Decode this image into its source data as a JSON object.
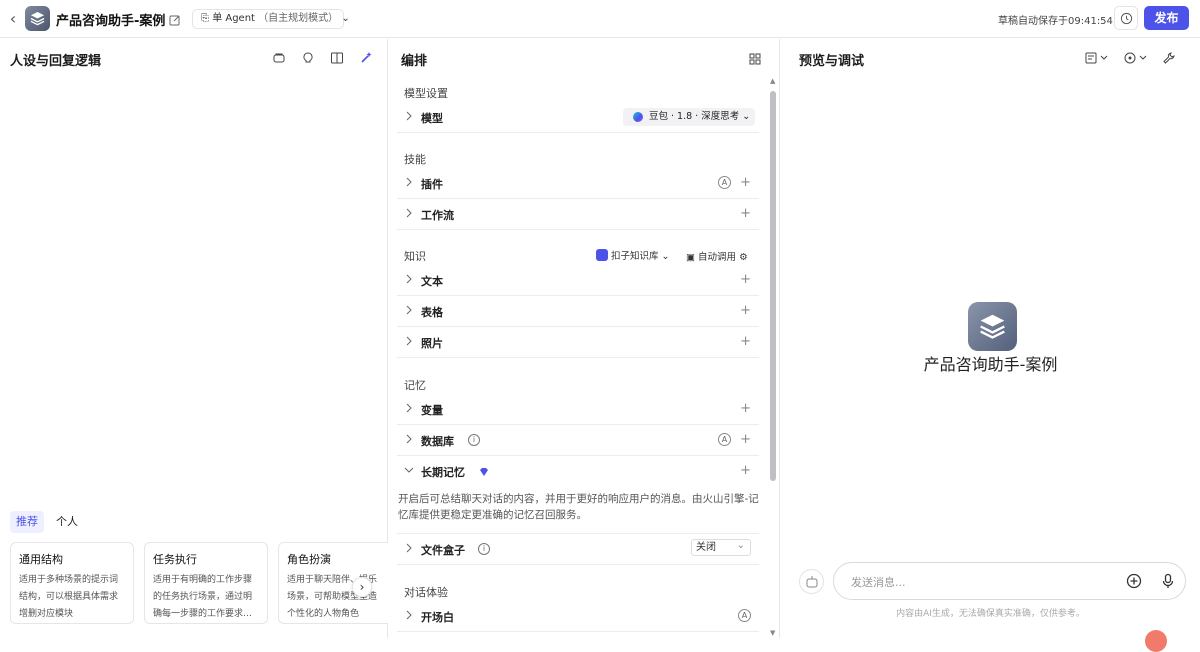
{
  "header": {
    "app_title": "产品咨询助手-案例",
    "mode_label": "单 Agent",
    "mode_sub": "（自主规划模式）",
    "autosave_text": "草稿自动保存于09:41:54",
    "publish_label": "发布"
  },
  "left": {
    "title": "人设与回复逻辑",
    "tabs": [
      "推荐",
      "个人"
    ],
    "cards": [
      {
        "title": "通用结构",
        "desc": "适用于多种场景的提示词结构，可以根据具体需求增删对应模块"
      },
      {
        "title": "任务执行",
        "desc": "适用于有明确的工作步骤的任务执行场景，通过明确每一步骤的工作要求…"
      },
      {
        "title": "角色扮演",
        "desc": "适用于聊天陪伴、娱乐场景，可帮助模型塑造个性化的人物角色"
      }
    ]
  },
  "middle": {
    "title": "编排",
    "sections": {
      "model": "模型设置",
      "skills": "技能",
      "knowledge": "知识",
      "memory": "记忆",
      "dialog": "对话体验"
    },
    "rows": {
      "model": "模型",
      "plugin": "插件",
      "workflow": "工作流",
      "text": "文本",
      "table": "表格",
      "photo": "照片",
      "variable": "变量",
      "database": "数据库",
      "longmem": "长期记忆",
      "filebox": "文件盒子",
      "opening": "开场白"
    },
    "model_value": "豆包 · 1.8 · 深度思考",
    "knowledge_source": "扣子知识库",
    "auto_call": "自动调用",
    "longmem_desc": "开启后可总结聊天对话的内容，并用于更好的响应用户的消息。由火山引擎-记忆库提供更稳定更准确的记忆召回服务。",
    "filebox_value": "关闭"
  },
  "right": {
    "title": "预览与调试",
    "bot_name": "产品咨询助手-案例",
    "input_placeholder": "发送消息...",
    "disclaimer": "内容由AI生成，无法确保真实准确，仅供参考。"
  },
  "colors": {
    "accent": "#4d53e8"
  }
}
